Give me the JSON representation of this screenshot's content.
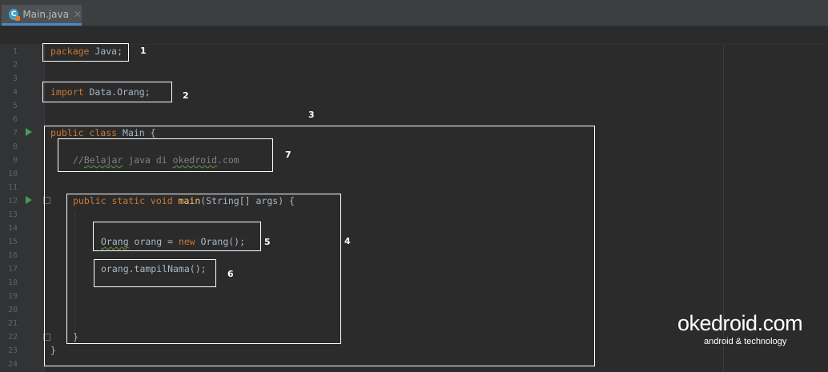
{
  "tab": {
    "filename": "Main.java",
    "icon": "java-class-icon",
    "close": "✕"
  },
  "line_numbers": [
    "1",
    "2",
    "3",
    "4",
    "5",
    "6",
    "7",
    "8",
    "9",
    "10",
    "11",
    "12",
    "13",
    "14",
    "15",
    "16",
    "17",
    "18",
    "19",
    "20",
    "21",
    "22",
    "23",
    "24"
  ],
  "code": {
    "l1": {
      "kw": "package",
      "rest": " Java;"
    },
    "l4": {
      "kw": "import",
      "rest": " Data.Orang;"
    },
    "l7": {
      "kw": "public class",
      "rest": " Main {"
    },
    "l9": {
      "slashes": "//",
      "w1": "Belajar",
      "mid": " java di ",
      "w2": "okedroid",
      "end": ".com"
    },
    "l12": {
      "kw": "public static void",
      "sp": " ",
      "fn": "main",
      "rest": "(String[] args) {"
    },
    "l15": {
      "w1": "Orang",
      "mid": " orang = ",
      "kw": "new",
      "rest": " Orang();"
    },
    "l17": {
      "rest": "orang.tampilNama();"
    },
    "l22": {
      "rest": "}"
    },
    "l23": {
      "rest": "}"
    }
  },
  "annotations": [
    "1",
    "2",
    "3",
    "4",
    "5",
    "6",
    "7"
  ],
  "watermark": {
    "brand": "okedroid.com",
    "tagline": "android & technology"
  }
}
